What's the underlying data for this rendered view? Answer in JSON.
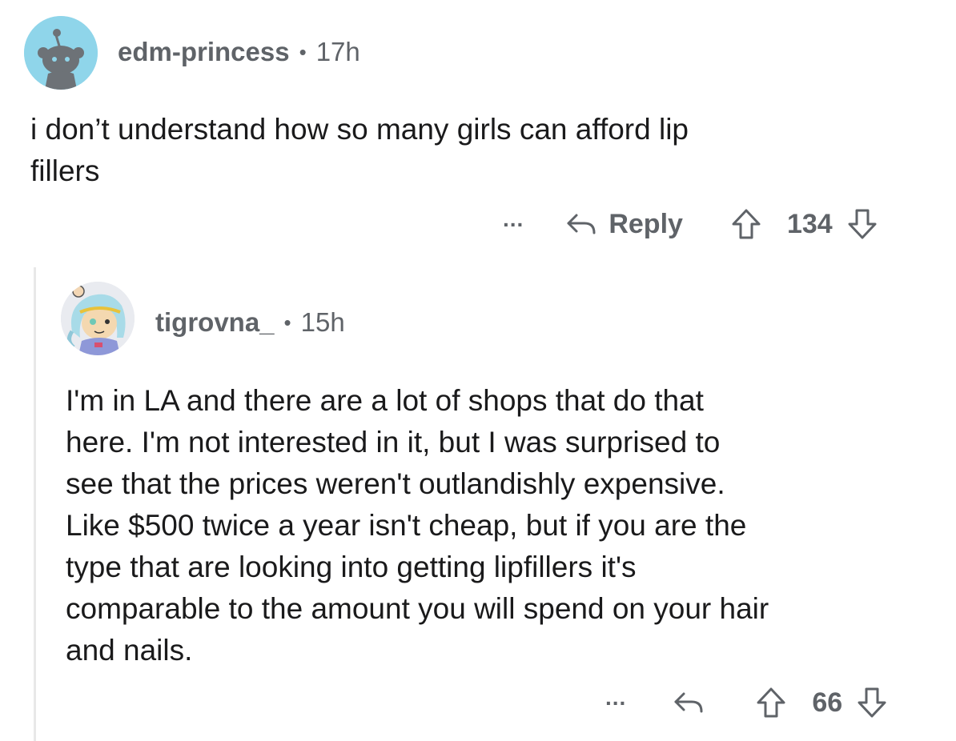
{
  "comments": [
    {
      "username": "edm-princess",
      "separator": "•",
      "time": "17h",
      "body_lines": [
        "i don’t understand how so many girls can afford lip",
        "fillers"
      ],
      "more_label": "...",
      "reply_label": "Reply",
      "score": "134",
      "avatar_icon": "reddit-default-snoo-avatar",
      "avatar_bg": "#8fd5ea"
    },
    {
      "username": "tigrovna_",
      "separator": "•",
      "time": "15h",
      "body_lines": [
        "I'm in LA and there are a lot of shops that do that",
        "here. I'm not interested in it, but I was surprised to",
        "see that the prices weren't outlandishly expensive.",
        "Like $500 twice a year isn't cheap, but if you are the",
        "type that are looking into getting lipfillers it's",
        "comparable to the amount you will spend on your hair",
        "and nails."
      ],
      "more_label": "...",
      "score": "66",
      "avatar_icon": "custom-character-avatar"
    }
  ],
  "colors": {
    "meta_text": "#5f6368",
    "body_text": "#1a1a1b",
    "thread_line": "#e8e8e8"
  }
}
